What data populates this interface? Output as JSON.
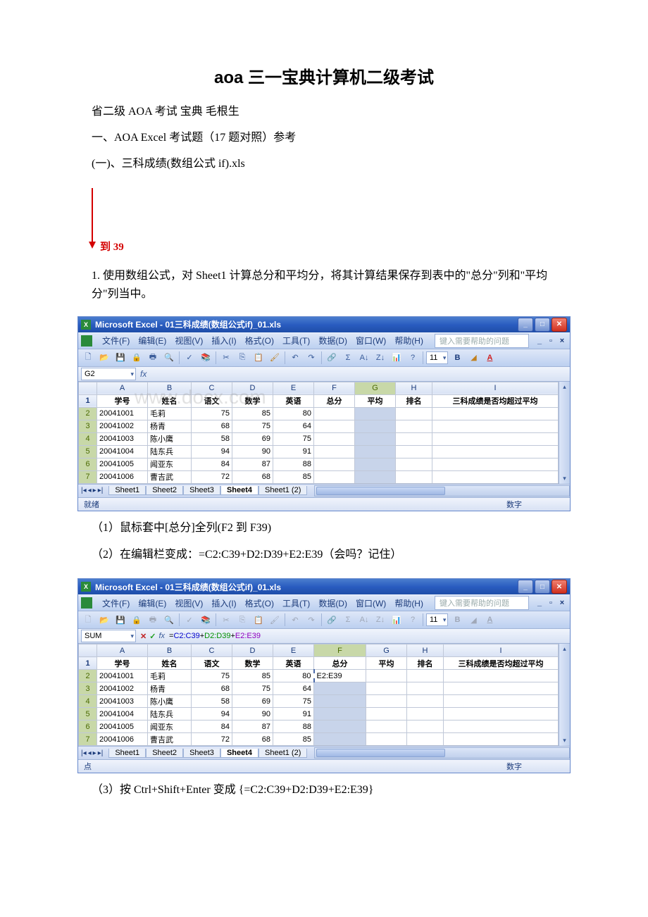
{
  "title": "aoa 三一宝典计算机二级考试",
  "intro": [
    "省二级 AOA 考试 宝典 毛根生",
    "一、AOA Excel 考试题（17 题对照）参考",
    "(一)、三科成绩(数组公式 if).xls"
  ],
  "arrow_label": "到 39",
  "para1": "1. 使用数组公式，对 Sheet1 计算总分和平均分，将其计算结果保存到表中的\"总分\"列和\"平均分\"列当中。",
  "steps": [
    "（1）鼠标套中[总分]全列(F2 到 F39)",
    "（2）在编辑栏变成：=C2:C39+D2:D39+E2:E39（会吗？记住）",
    "（3）按 Ctrl+Shift+Enter 变成 {=C2:C39+D2:D39+E2:E39}"
  ],
  "excel": {
    "window_title": "Microsoft Excel - 01三科成绩(数组公式if)_01.xls",
    "menus": [
      "文件(F)",
      "编辑(E)",
      "视图(V)",
      "插入(I)",
      "格式(O)",
      "工具(T)",
      "数据(D)",
      "窗口(W)",
      "帮助(H)"
    ],
    "help_placeholder": "键入需要帮助的问题",
    "font_size": "11",
    "sheets": [
      "Sheet1",
      "Sheet2",
      "Sheet3",
      "Sheet4",
      "Sheet1 (2)"
    ],
    "status_ready": "就绪",
    "status_mode": "数字"
  },
  "screenshot1": {
    "name_box": "G2",
    "formula": "",
    "sel_col": "G",
    "sel_row_start": 2,
    "headers": [
      "学号",
      "姓名",
      "语文",
      "数学",
      "英语",
      "总分",
      "平均",
      "排名",
      "三科成绩是否均超过平均"
    ],
    "cols": [
      "A",
      "B",
      "C",
      "D",
      "E",
      "F",
      "G",
      "H",
      "I"
    ],
    "rows": [
      {
        "r": 1,
        "cells": [
          "学号",
          "姓名",
          "语文",
          "数学",
          "英语",
          "总分",
          "平均",
          "排名",
          "三科成绩是否均超过平均"
        ]
      },
      {
        "r": 2,
        "cells": [
          "20041001",
          "毛莉",
          "75",
          "85",
          "80",
          "",
          "",
          "",
          ""
        ]
      },
      {
        "r": 3,
        "cells": [
          "20041002",
          "杨青",
          "68",
          "75",
          "64",
          "",
          "",
          "",
          ""
        ]
      },
      {
        "r": 4,
        "cells": [
          "20041003",
          "陈小鹰",
          "58",
          "69",
          "75",
          "",
          "",
          "",
          ""
        ]
      },
      {
        "r": 5,
        "cells": [
          "20041004",
          "陆东兵",
          "94",
          "90",
          "91",
          "",
          "",
          "",
          ""
        ]
      },
      {
        "r": 6,
        "cells": [
          "20041005",
          "闻亚东",
          "84",
          "87",
          "88",
          "",
          "",
          "",
          ""
        ]
      },
      {
        "r": 7,
        "cells": [
          "20041006",
          "曹吉武",
          "72",
          "68",
          "85",
          "",
          "",
          "",
          ""
        ]
      }
    ]
  },
  "screenshot2": {
    "name_box": "SUM",
    "formula_parts": [
      "=",
      "C2:C39",
      "+",
      "D2:D39",
      "+",
      "E2:E39"
    ],
    "sel_col": "F",
    "focus_text": "80 E2:E39",
    "headers": [
      "学号",
      "姓名",
      "语文",
      "数学",
      "英语",
      "总分",
      "平均",
      "排名",
      "三科成绩是否均超过平均"
    ],
    "cols": [
      "A",
      "B",
      "C",
      "D",
      "E",
      "F",
      "G",
      "H",
      "I"
    ],
    "rows": [
      {
        "r": 1,
        "cells": [
          "学号",
          "姓名",
          "语文",
          "数学",
          "英语",
          "总分",
          "平均",
          "排名",
          "三科成绩是否均超过平均"
        ]
      },
      {
        "r": 2,
        "cells": [
          "20041001",
          "毛莉",
          "75",
          "85",
          "80",
          "E2:E39",
          "",
          "",
          ""
        ]
      },
      {
        "r": 3,
        "cells": [
          "20041002",
          "杨青",
          "68",
          "75",
          "64",
          "",
          "",
          "",
          ""
        ]
      },
      {
        "r": 4,
        "cells": [
          "20041003",
          "陈小鹰",
          "58",
          "69",
          "75",
          "",
          "",
          "",
          ""
        ]
      },
      {
        "r": 5,
        "cells": [
          "20041004",
          "陆东兵",
          "94",
          "90",
          "91",
          "",
          "",
          "",
          ""
        ]
      },
      {
        "r": 6,
        "cells": [
          "20041005",
          "闻亚东",
          "84",
          "87",
          "88",
          "",
          "",
          "",
          ""
        ]
      },
      {
        "r": 7,
        "cells": [
          "20041006",
          "曹吉武",
          "72",
          "68",
          "85",
          "",
          "",
          "",
          ""
        ]
      }
    ]
  },
  "chart_data": {
    "type": "table",
    "columns": [
      "学号",
      "姓名",
      "语文",
      "数学",
      "英语"
    ],
    "rows": [
      [
        "20041001",
        "毛莉",
        75,
        85,
        80
      ],
      [
        "20041002",
        "杨青",
        68,
        75,
        64
      ],
      [
        "20041003",
        "陈小鹰",
        58,
        69,
        75
      ],
      [
        "20041004",
        "陆东兵",
        94,
        90,
        91
      ],
      [
        "20041005",
        "闻亚东",
        84,
        87,
        88
      ],
      [
        "20041006",
        "曹吉武",
        72,
        68,
        85
      ]
    ]
  }
}
